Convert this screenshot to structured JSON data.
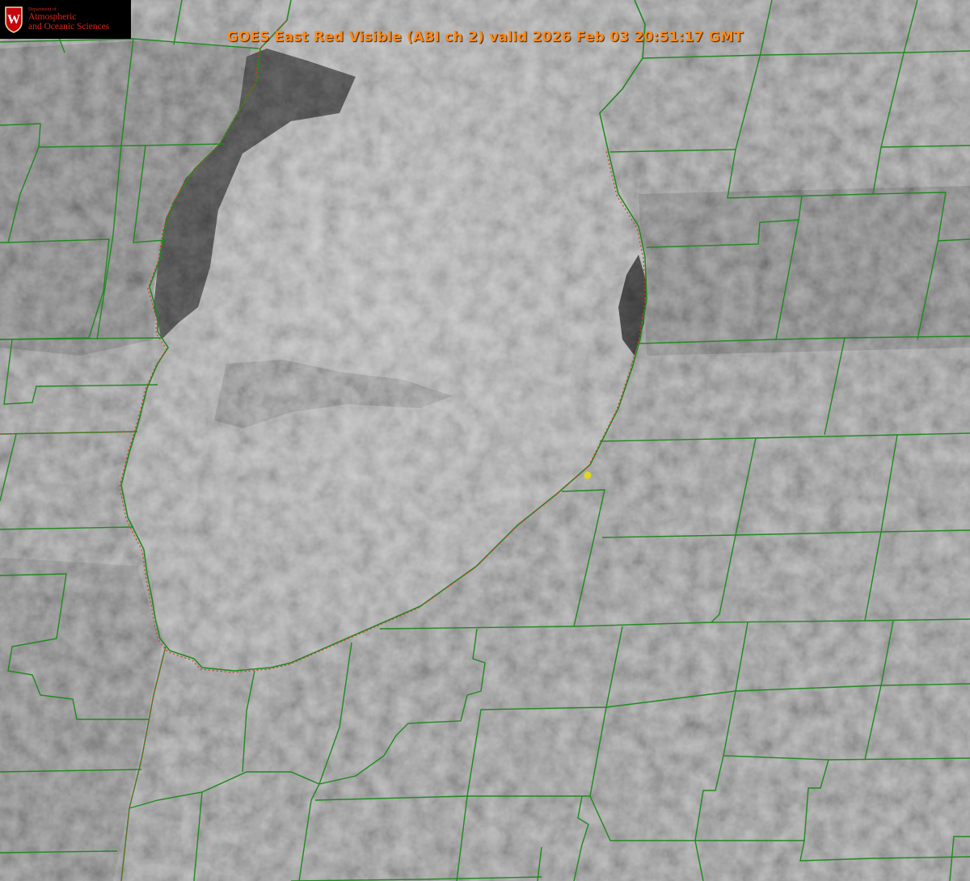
{
  "title": "GOES East Red Visible (ABI ch 2) valid 2026 Feb 03 20:51:17 GMT",
  "logo": {
    "dept": "Department of",
    "line1": "Atmospheric",
    "line2": "and Oceanic Sciences",
    "crest_letter": "W",
    "icon": "uw-crest-icon"
  },
  "colors": {
    "title": "#ff8a1c",
    "boundary_lines": "#1f8a1f",
    "shoreline_dotted": "#e0302a",
    "marker": "#e0d81c",
    "lake_dark_water": "#2e2e2e",
    "cloud_gray": "#9a9a9a"
  },
  "map": {
    "features": [
      "county-boundaries",
      "lake-shoreline",
      "observation-marker"
    ]
  }
}
